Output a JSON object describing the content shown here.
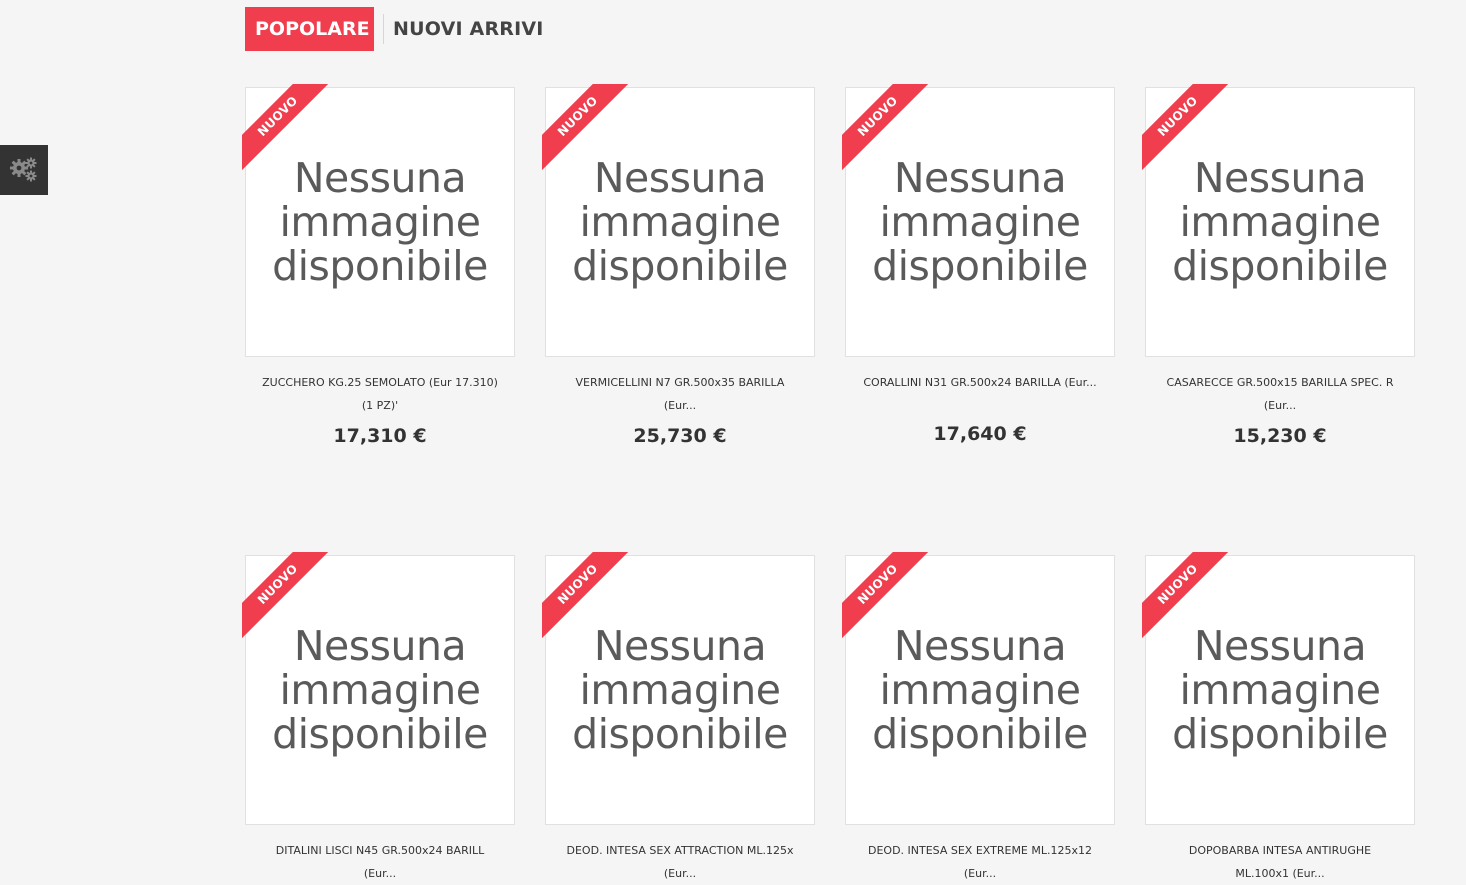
{
  "tabs": {
    "popular": "POPOLARE",
    "new_arrivals": "NUOVI ARRIVI"
  },
  "settings": {
    "icon": "gears-icon"
  },
  "colors": {
    "accent": "#f03e4e",
    "dark": "#333333",
    "background": "#f5f5f5"
  },
  "ribbon_label": "NUOVO",
  "no_image_text": {
    "line1": "Nessuna",
    "line2": "immagine",
    "line3": "disponibile"
  },
  "products": [
    {
      "name_line1": "ZUCCHERO KG.25 SEMOLATO (Eur 17.310)",
      "name_line2": "(1 PZ)'",
      "price": "17,310 €"
    },
    {
      "name_line1": "VERMICELLINI N7 GR.500x35 BARILLA",
      "name_line2": "(Eur...",
      "price": "25,730 €"
    },
    {
      "name_line1": "CORALLINI N31 GR.500x24 BARILLA (Eur...",
      "name_line2": "",
      "price": "17,640 €"
    },
    {
      "name_line1": "CASARECCE GR.500x15 BARILLA SPEC. R",
      "name_line2": "(Eur...",
      "price": "15,230 €"
    },
    {
      "name_line1": "DITALINI LISCI N45 GR.500x24 BARILL",
      "name_line2": "(Eur...",
      "price": ""
    },
    {
      "name_line1": "DEOD. INTESA SEX ATTRACTION ML.125x",
      "name_line2": "(Eur...",
      "price": ""
    },
    {
      "name_line1": "DEOD. INTESA SEX EXTREME ML.125x12",
      "name_line2": "(Eur...",
      "price": ""
    },
    {
      "name_line1": "DOPOBARBA INTESA ANTIRUGHE",
      "name_line2": "ML.100x1 (Eur...",
      "price": ""
    }
  ]
}
